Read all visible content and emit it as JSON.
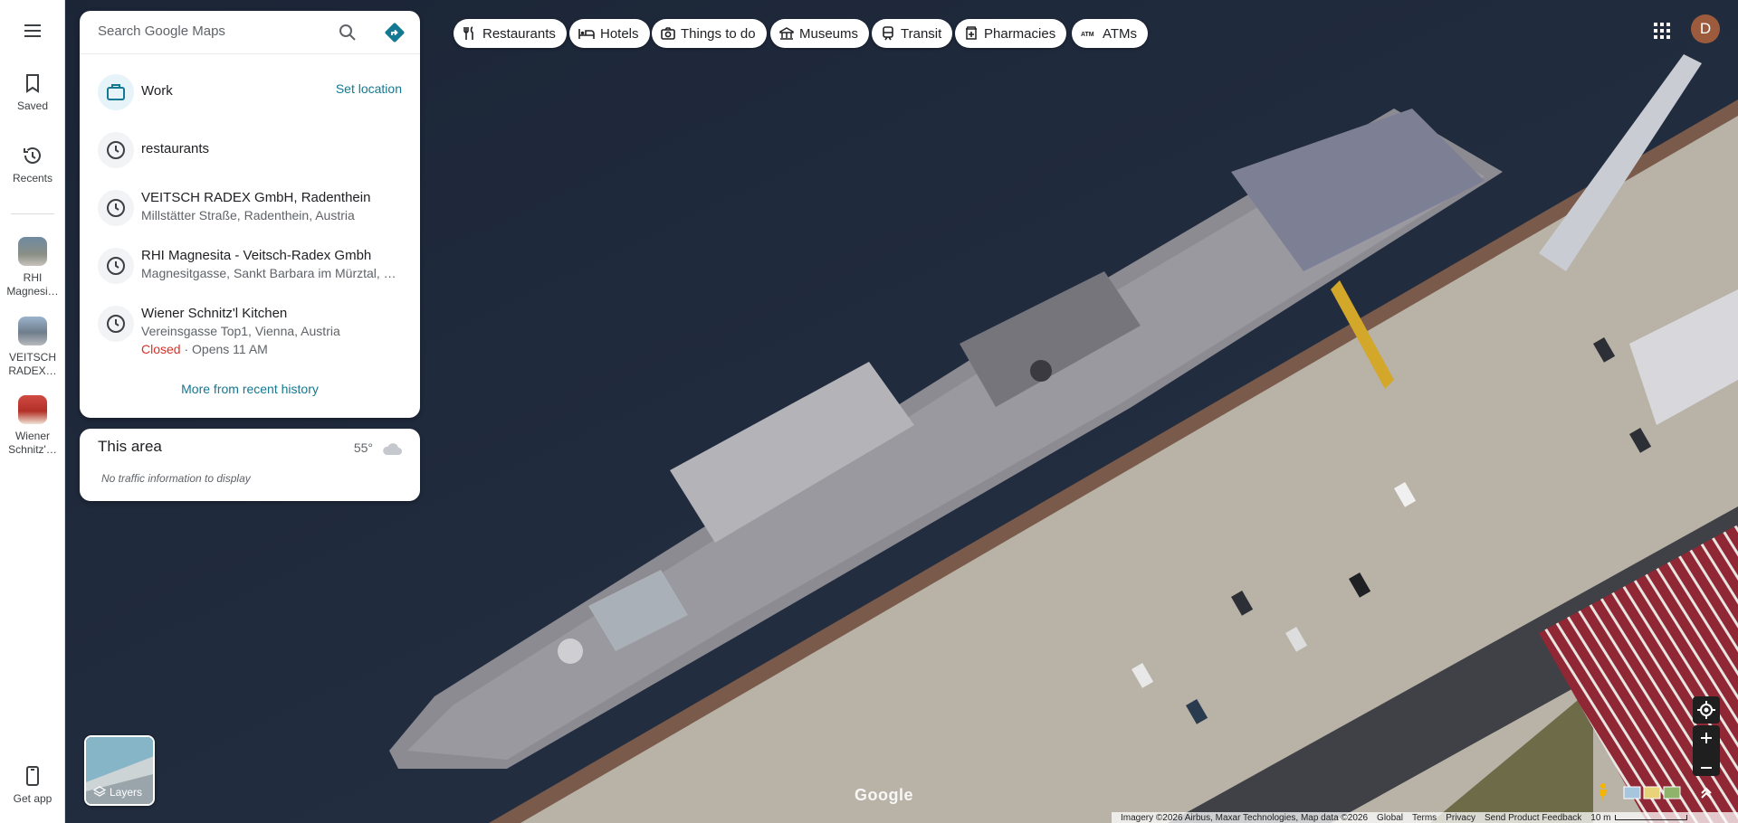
{
  "rail": {
    "saved": "Saved",
    "recents": "Recents",
    "recent_places": [
      {
        "label": "RHI Magnesi…"
      },
      {
        "label": "VEITSCH RADEX…"
      },
      {
        "label": "Wiener Schnitz'…"
      }
    ],
    "get_app": "Get app"
  },
  "search": {
    "placeholder": "Search Google Maps"
  },
  "work": {
    "label": "Work",
    "action": "Set location"
  },
  "history": [
    {
      "title": "restaurants"
    },
    {
      "title": "VEITSCH RADEX GmbH, Radenthein",
      "subtitle": "Millstätter Straße, Radenthein, Austria"
    },
    {
      "title": "RHI Magnesita - Veitsch-Radex Gmbh",
      "subtitle": "Magnesitgasse, Sankt Barbara im Mürztal, …"
    },
    {
      "title": "Wiener Schnitz'l Kitchen",
      "subtitle": "Vereinsgasse Top1, Vienna, Austria",
      "status_closed": "Closed",
      "status_rest": " · Opens 11 AM"
    }
  ],
  "more_history": "More from recent history",
  "area": {
    "title": "This area",
    "temperature": "55°",
    "traffic": "No traffic information to display"
  },
  "chips": [
    {
      "label": "Restaurants",
      "icon": "fork-knife-icon"
    },
    {
      "label": "Hotels",
      "icon": "bed-icon"
    },
    {
      "label": "Things to do",
      "icon": "camera-icon"
    },
    {
      "label": "Museums",
      "icon": "museum-icon"
    },
    {
      "label": "Transit",
      "icon": "train-icon"
    },
    {
      "label": "Pharmacies",
      "icon": "pharmacy-icon"
    },
    {
      "label": "ATMs",
      "icon": "atm-icon"
    }
  ],
  "account": {
    "initial": "D"
  },
  "layers": {
    "label": "Layers"
  },
  "map": {
    "logo": "Google",
    "attribution": "Imagery ©2026 Airbus, Maxar Technologies, Map data ©2026",
    "links": [
      "Global",
      "Terms",
      "Privacy",
      "Send Product Feedback"
    ],
    "scale": "10 m"
  },
  "colors": {
    "accent": "#137891",
    "closed": "#d93025",
    "water": "#1d2838",
    "dock": "#b9b2a7"
  }
}
